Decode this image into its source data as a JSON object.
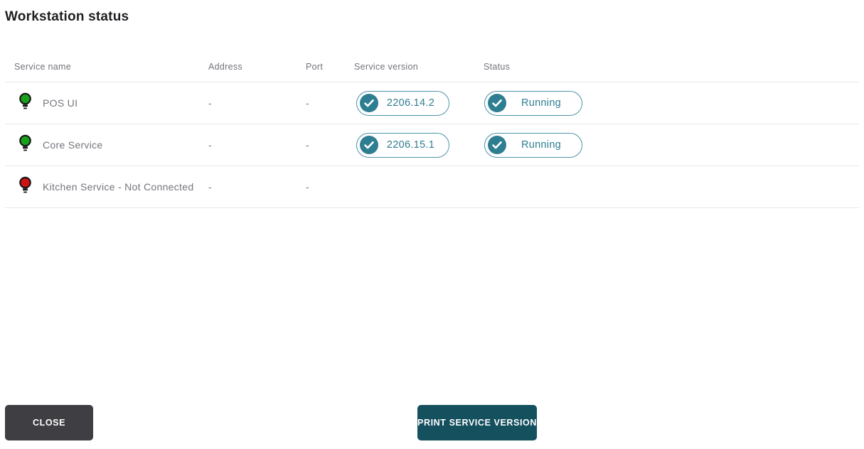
{
  "page": {
    "title": "Workstation status"
  },
  "table": {
    "headers": {
      "service_name": "Service name",
      "address": "Address",
      "port": "Port",
      "service_version": "Service version",
      "status": "Status"
    },
    "rows": [
      {
        "indicator": "green",
        "name": "POS UI",
        "address": "-",
        "port": "-",
        "version": "2206.14.2",
        "status": "Running"
      },
      {
        "indicator": "green",
        "name": "Core Service",
        "address": "-",
        "port": "-",
        "version": "2206.15.1",
        "status": "Running"
      },
      {
        "indicator": "red",
        "name": "Kitchen Service - Not Connected",
        "address": "-",
        "port": "-",
        "version": "",
        "status": ""
      }
    ]
  },
  "footer": {
    "close_button": "CLOSE",
    "print_button": "PRINT SERVICE VERSION"
  },
  "icons": {
    "row_indicator_ok": "bulb-icon-green",
    "row_indicator_error": "bulb-icon-red",
    "badge_icon": "check-circle-icon"
  },
  "colors": {
    "badge_teal": "#2e7e91",
    "badge_border": "#4b93a6",
    "bulb_green": "#18a21c",
    "bulb_red": "#cf1212",
    "close_button_bg": "#3f3f43",
    "print_button_bg": "#15505f",
    "divider": "#e8e8e8"
  }
}
